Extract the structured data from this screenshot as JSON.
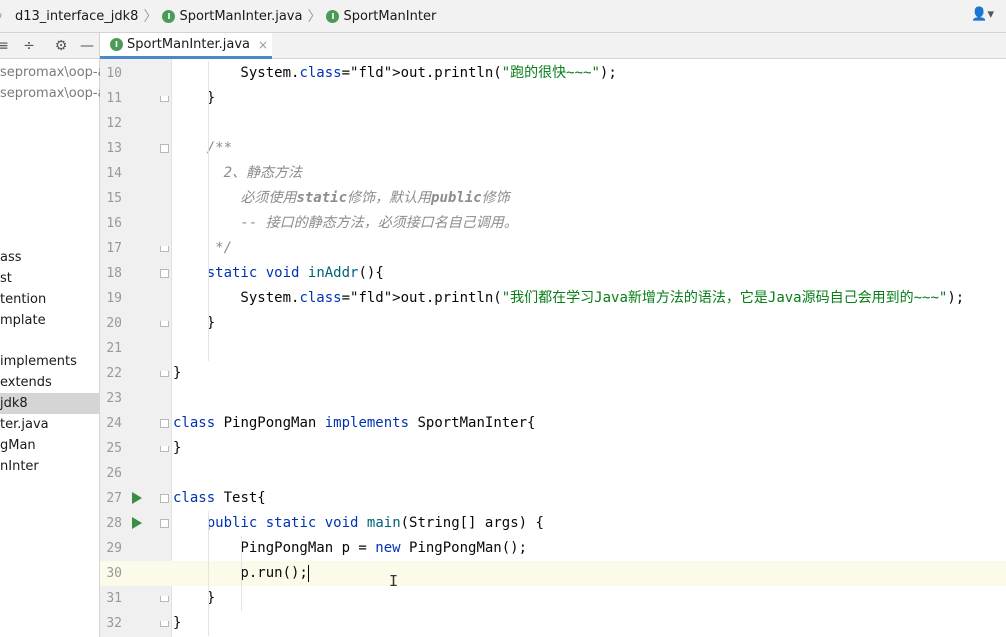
{
  "breadcrumb": {
    "project": "d13_interface_jdk8",
    "file": "SportManInter.java",
    "symbol": "SportManInter"
  },
  "tab": {
    "label": "SportManInter.java"
  },
  "project_panel": {
    "items": [
      {
        "label": "sepromax\\oop-a",
        "style": "gray"
      },
      {
        "label": "sepromax\\oop-a",
        "style": "gray"
      },
      {
        "label": "ass",
        "style": ""
      },
      {
        "label": "st",
        "style": ""
      },
      {
        "label": "tention",
        "style": ""
      },
      {
        "label": "mplate",
        "style": ""
      },
      {
        "label": "implements",
        "style": ""
      },
      {
        "label": "extends",
        "style": ""
      },
      {
        "label": "jdk8",
        "style": "selected"
      },
      {
        "label": "ter.java",
        "style": ""
      },
      {
        "label": "gMan",
        "style": ""
      },
      {
        "label": "nInter",
        "style": ""
      }
    ]
  },
  "editor": {
    "lines": [
      {
        "n": "10",
        "t": "        System.out.println(\"跑的很快~~~\");"
      },
      {
        "n": "11",
        "t": "    }"
      },
      {
        "n": "12",
        "t": ""
      },
      {
        "n": "13",
        "t": "    /**"
      },
      {
        "n": "14",
        "t": "      2、静态方法"
      },
      {
        "n": "15",
        "t": "        必须使用static修饰，默认用public修饰"
      },
      {
        "n": "16",
        "t": "        -- 接口的静态方法，必须接口名自己调用。"
      },
      {
        "n": "17",
        "t": "     */"
      },
      {
        "n": "18",
        "t": "    static void inAddr(){"
      },
      {
        "n": "19",
        "t": "        System.out.println(\"我们都在学习Java新增方法的语法，它是Java源码自己会用到的~~~\");"
      },
      {
        "n": "20",
        "t": "    }"
      },
      {
        "n": "21",
        "t": ""
      },
      {
        "n": "22",
        "t": "}"
      },
      {
        "n": "23",
        "t": ""
      },
      {
        "n": "24",
        "t": "class PingPongMan implements SportManInter{"
      },
      {
        "n": "25",
        "t": "}"
      },
      {
        "n": "26",
        "t": ""
      },
      {
        "n": "27",
        "t": "class Test{"
      },
      {
        "n": "28",
        "t": "    public static void main(String[] args) {"
      },
      {
        "n": "29",
        "t": "        PingPongMan p = new PingPongMan();"
      },
      {
        "n": "30",
        "t": "        p.run();"
      },
      {
        "n": "31",
        "t": "    }"
      },
      {
        "n": "32",
        "t": "}"
      }
    ]
  },
  "colors": {
    "keyword": "#0033b3",
    "string": "#067d17",
    "comment": "#8c8c8c",
    "field": "#871094",
    "method": "#00627a",
    "run_gutter": "#3c8c46",
    "tab_underline": "#4a88c7"
  },
  "icons": {
    "interface_badge": "I",
    "user": "👤▾",
    "tools": [
      "≡",
      "÷",
      "⚙",
      "—"
    ],
    "close": "×",
    "chevron": "〉"
  }
}
